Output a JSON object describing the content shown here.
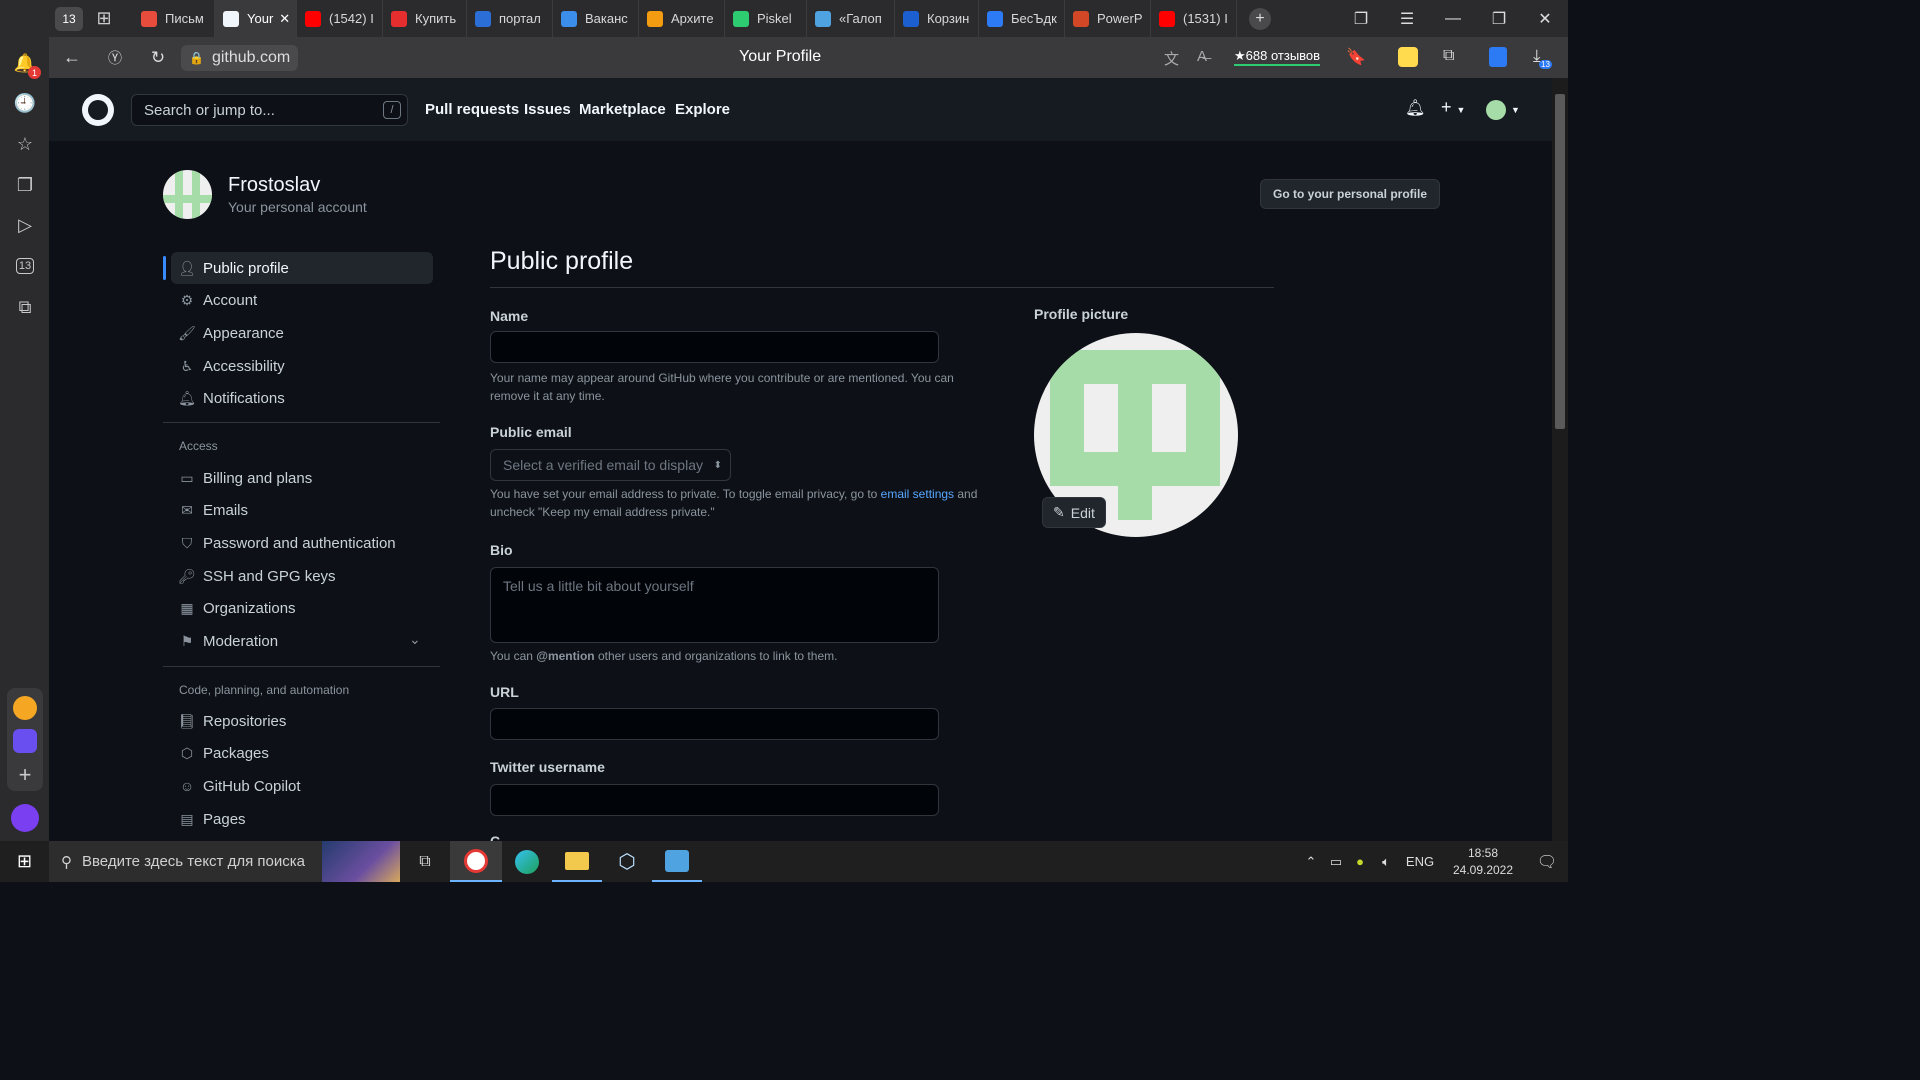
{
  "browser": {
    "tab_counter": "13",
    "tabs": [
      {
        "label": "Письм",
        "color": "#e74c3c"
      },
      {
        "label": "Your",
        "color": "#f0f6fc",
        "active": true
      },
      {
        "label": "(1542) I",
        "color": "#ff0000"
      },
      {
        "label": "Купить",
        "color": "#e62e2e"
      },
      {
        "label": "портал",
        "color": "#2b6fd6"
      },
      {
        "label": "Ваканс",
        "color": "#3b8eea"
      },
      {
        "label": "Архите",
        "color": "#f39c12"
      },
      {
        "label": "Piskel",
        "color": "#2ecc71"
      },
      {
        "label": "«Галоп",
        "color": "#4fa3e0"
      },
      {
        "label": "Корзин",
        "color": "#1c5fd0"
      },
      {
        "label": "БесЪдк",
        "color": "#2d7bf4"
      },
      {
        "label": "PowerP",
        "color": "#d24726"
      },
      {
        "label": "(1531) I",
        "color": "#ff0000"
      }
    ],
    "url": "github.com",
    "page_title": "Your Profile",
    "reviews": "★688 отзывов",
    "notification_count": "1",
    "sidebar_badge": "13",
    "downloads_badge": "13"
  },
  "github": {
    "search_placeholder": "Search or jump to...",
    "search_key": "/",
    "nav": [
      "Pull requests",
      "Issues",
      "Marketplace",
      "Explore"
    ]
  },
  "account": {
    "name": "Frostoslav",
    "subtitle": "Your personal account",
    "go_profile": "Go to your personal profile"
  },
  "sidebar": {
    "items": [
      {
        "label": "Public profile",
        "icon": "person-icon"
      },
      {
        "label": "Account",
        "icon": "gear-icon"
      },
      {
        "label": "Appearance",
        "icon": "paintbrush-icon"
      },
      {
        "label": "Accessibility",
        "icon": "accessibility-icon"
      },
      {
        "label": "Notifications",
        "icon": "bell-icon"
      }
    ],
    "access_heading": "Access",
    "access_items": [
      {
        "label": "Billing and plans",
        "icon": "credit-card-icon"
      },
      {
        "label": "Emails",
        "icon": "mail-icon"
      },
      {
        "label": "Password and authentication",
        "icon": "shield-icon"
      },
      {
        "label": "SSH and GPG keys",
        "icon": "key-icon"
      },
      {
        "label": "Organizations",
        "icon": "organization-icon"
      },
      {
        "label": "Moderation",
        "icon": "report-icon"
      }
    ],
    "code_heading": "Code, planning, and automation",
    "code_items": [
      {
        "label": "Repositories",
        "icon": "repo-icon"
      },
      {
        "label": "Packages",
        "icon": "package-icon"
      },
      {
        "label": "GitHub Copilot",
        "icon": "copilot-icon"
      },
      {
        "label": "Pages",
        "icon": "browser-icon"
      }
    ]
  },
  "form": {
    "heading": "Public profile",
    "name_label": "Name",
    "name_note": "Your name may appear around GitHub where you contribute or are mentioned. You can remove it at any time.",
    "email_label": "Public email",
    "email_placeholder": "Select a verified email to display",
    "email_note_1": "You have set your email address to private. To toggle email privacy, go to ",
    "email_note_link": "email settings",
    "email_note_2": " and uncheck \"Keep my email address private.\"",
    "bio_label": "Bio",
    "bio_placeholder": "Tell us a little bit about yourself",
    "bio_note_1": "You can ",
    "bio_note_mention": "@mention",
    "bio_note_2": " other users and organizations to link to them.",
    "url_label": "URL",
    "twitter_label": "Twitter username",
    "picture_label": "Profile picture",
    "edit_label": "Edit"
  },
  "taskbar": {
    "search_placeholder": "Введите здесь текст для поиска",
    "language": "ENG",
    "time": "18:58",
    "date": "24.09.2022"
  }
}
